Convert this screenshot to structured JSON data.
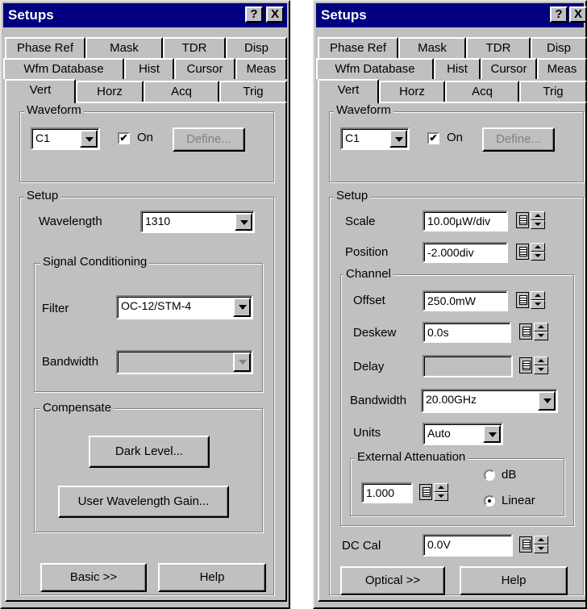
{
  "left": {
    "title": "Setups",
    "help_btn": "?",
    "close_btn": "X",
    "tabs_row1": [
      "Phase Ref",
      "Mask",
      "TDR",
      "Disp"
    ],
    "tabs_row2": [
      "Wfm Database",
      "Hist",
      "Cursor",
      "Meas"
    ],
    "tabs_row3": [
      "Vert",
      "Horz",
      "Acq",
      "Trig"
    ],
    "active_tab": "Vert",
    "waveform": {
      "label": "Waveform",
      "channel": "C1",
      "on_label": "On",
      "on_checked": true,
      "define_label": "Define..."
    },
    "setup": {
      "label": "Setup",
      "wavelength_label": "Wavelength",
      "wavelength_value": "1310",
      "signal_conditioning": {
        "label": "Signal Conditioning",
        "filter_label": "Filter",
        "filter_value": "OC-12/STM-4",
        "bandwidth_label": "Bandwidth",
        "bandwidth_value": ""
      },
      "compensate": {
        "label": "Compensate",
        "dark_level": "Dark Level...",
        "user_gain": "User Wavelength Gain..."
      }
    },
    "footer": {
      "basic": "Basic >>",
      "help": "Help"
    }
  },
  "right": {
    "title": "Setups",
    "help_btn": "?",
    "close_btn": "X",
    "tabs_row1": [
      "Phase Ref",
      "Mask",
      "TDR",
      "Disp"
    ],
    "tabs_row2": [
      "Wfm Database",
      "Hist",
      "Cursor",
      "Meas"
    ],
    "tabs_row3": [
      "Vert",
      "Horz",
      "Acq",
      "Trig"
    ],
    "active_tab": "Vert",
    "waveform": {
      "label": "Waveform",
      "channel": "C1",
      "on_label": "On",
      "on_checked": true,
      "define_label": "Define..."
    },
    "setup": {
      "label": "Setup",
      "scale_label": "Scale",
      "scale_value": "10.00µW/div",
      "position_label": "Position",
      "position_value": "-2.000div",
      "channel": {
        "label": "Channel",
        "offset_label": "Offset",
        "offset_value": "250.0mW",
        "deskew_label": "Deskew",
        "deskew_value": "0.0s",
        "delay_label": "Delay",
        "delay_value": "",
        "bandwidth_label": "Bandwidth",
        "bandwidth_value": "20.00GHz",
        "units_label": "Units",
        "units_value": "Auto",
        "ext_atten": {
          "label": "External Attenuation",
          "value": "1.000",
          "db_label": "dB",
          "linear_label": "Linear",
          "selected": "Linear"
        }
      },
      "dccal_label": "DC Cal",
      "dccal_value": "0.0V"
    },
    "footer": {
      "optical": "Optical >>",
      "help": "Help"
    }
  }
}
